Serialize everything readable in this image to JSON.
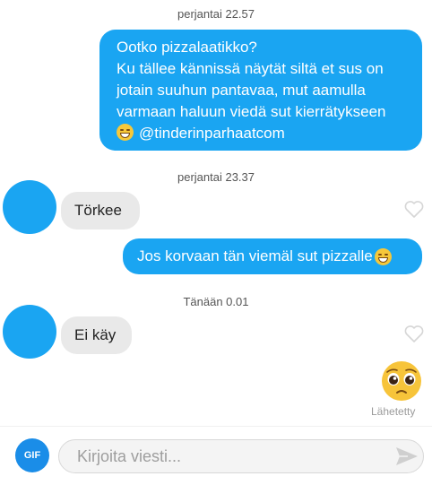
{
  "timestamps": [
    "perjantai 22.57",
    "perjantai 23.37",
    "Tänään 0.01"
  ],
  "messages": {
    "m1": {
      "line1": "Ootko pizzalaatikko?",
      "line2": "Ku tällee kännissä näytät siltä et sus on",
      "line3": "jotain suuhun pantavaa, mut aamulla",
      "line4": "varmaan haluun viedä sut kierrätykseen",
      "line5": "@tinderinparhaatcom",
      "emoji": "grimacing-blush-emoji"
    },
    "m2": {
      "text": "Törkee"
    },
    "m3": {
      "text": "Jos korvaan tän viemäl sut pizzalle",
      "emoji": "laughing-emoji"
    },
    "m4": {
      "text": "Ei käy"
    },
    "m5": {
      "emoji": "pleading-face-emoji",
      "status": "Lähetetty"
    }
  },
  "composer": {
    "gif_label": "GIF",
    "placeholder": "Kirjoita viesti...",
    "send_icon": "send-icon"
  },
  "colors": {
    "outgoing_bubble": "#1aa5f2",
    "incoming_bubble": "#e9e9e9",
    "avatar": "#1aa5f2",
    "gif_button": "#1a8de8"
  }
}
